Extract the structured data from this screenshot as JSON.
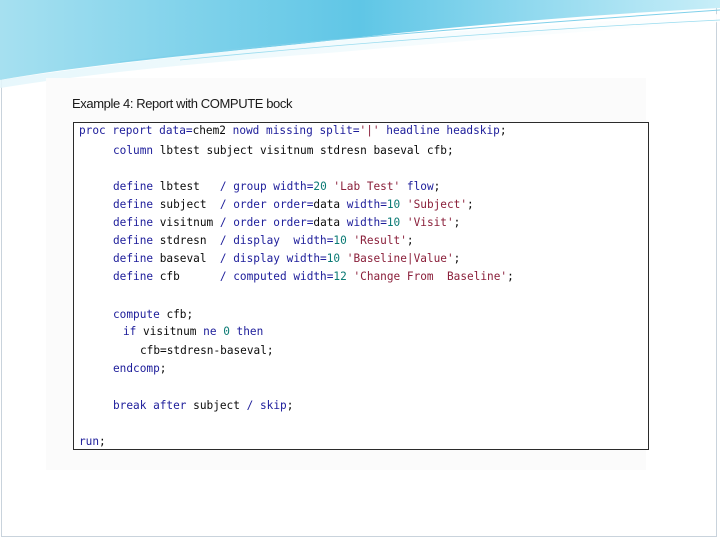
{
  "slide": {
    "title": "Example 4: Report with COMPUTE bock"
  },
  "code": {
    "l1": [
      [
        "kw",
        "proc report"
      ],
      [
        "kw",
        " data="
      ],
      [
        "",
        "chem2 "
      ],
      [
        "kw",
        "nowd missing split="
      ],
      [
        "str",
        "'|'"
      ],
      [
        "kw",
        " headline headskip"
      ],
      [
        "",
        ";"
      ]
    ],
    "l2": [
      [
        "kw",
        "column"
      ],
      [
        "",
        " lbtest subject visitnum stdresn baseval cfb;"
      ]
    ],
    "l3": [
      [
        "kw",
        "define"
      ],
      [
        "",
        " lbtest   "
      ],
      [
        "kw",
        "/ group width="
      ],
      [
        "num",
        "20"
      ],
      [
        "str",
        " 'Lab Test'"
      ],
      [
        "kw",
        " flow"
      ],
      [
        "",
        ";"
      ]
    ],
    "l4": [
      [
        "kw",
        "define"
      ],
      [
        "",
        " subject  "
      ],
      [
        "kw",
        "/ order order="
      ],
      [
        "",
        "data "
      ],
      [
        "kw",
        "width="
      ],
      [
        "num",
        "10"
      ],
      [
        "str",
        " 'Subject'"
      ],
      [
        "",
        ";"
      ]
    ],
    "l5": [
      [
        "kw",
        "define"
      ],
      [
        "",
        " visitnum "
      ],
      [
        "kw",
        "/ order order="
      ],
      [
        "",
        "data "
      ],
      [
        "kw",
        "width="
      ],
      [
        "num",
        "10"
      ],
      [
        "str",
        " 'Visit'"
      ],
      [
        "",
        ";"
      ]
    ],
    "l6": [
      [
        "kw",
        "define"
      ],
      [
        "",
        " stdresn  "
      ],
      [
        "kw",
        "/ display  width="
      ],
      [
        "num",
        "10"
      ],
      [
        "str",
        " 'Result'"
      ],
      [
        "",
        ";"
      ]
    ],
    "l7": [
      [
        "kw",
        "define"
      ],
      [
        "",
        " baseval  "
      ],
      [
        "kw",
        "/ display width="
      ],
      [
        "num",
        "10"
      ],
      [
        "str",
        " 'Baseline|Value'"
      ],
      [
        "",
        ";"
      ]
    ],
    "l8": [
      [
        "kw",
        "define"
      ],
      [
        "",
        " cfb      "
      ],
      [
        "kw",
        "/ computed width="
      ],
      [
        "num",
        "12"
      ],
      [
        "str",
        " 'Change From  Baseline'"
      ],
      [
        "",
        ";"
      ]
    ],
    "l9": [
      [
        "kw",
        "compute"
      ],
      [
        "",
        " cfb;"
      ]
    ],
    "l10": [
      [
        "kw",
        "if"
      ],
      [
        "",
        " visitnum "
      ],
      [
        "kw",
        "ne"
      ],
      [
        "num",
        " 0"
      ],
      [
        "kw",
        " then"
      ]
    ],
    "l11": [
      [
        "",
        "cfb=stdresn-baseval;"
      ]
    ],
    "l12": [
      [
        "kw",
        "endcomp"
      ],
      [
        "",
        ";"
      ]
    ],
    "l13": [
      [
        "kw",
        "break after"
      ],
      [
        "",
        " subject "
      ],
      [
        "kw",
        "/ skip"
      ],
      [
        "",
        ";"
      ]
    ],
    "l14": [
      [
        "kw",
        "run"
      ],
      [
        "",
        ";"
      ]
    ]
  },
  "colors": {
    "keyword": "#1c1c9a",
    "number": "#0a7a74",
    "string": "#8a1f3a",
    "header_swoosh": "#5fc6e6"
  }
}
